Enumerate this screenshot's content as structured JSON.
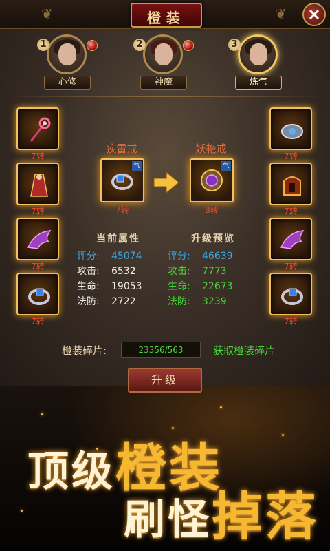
{
  "title": "橙装",
  "heroes": [
    {
      "num": "1",
      "label": "心修",
      "selected": false
    },
    {
      "num": "2",
      "label": "神魔",
      "selected": false
    },
    {
      "num": "3",
      "label": "炼气",
      "selected": true
    }
  ],
  "left_slots": [
    "7转",
    "7转",
    "7转",
    "7转"
  ],
  "right_slots": [
    "7转",
    "7转",
    "7转",
    "7转"
  ],
  "current_item": {
    "name": "疾雷戒",
    "level": "7转",
    "tag": "气"
  },
  "next_item": {
    "name": "妖艳戒",
    "level": "8转",
    "tag": "气"
  },
  "current_stats": {
    "header": "当前属性",
    "rows": [
      {
        "label": "评分:",
        "value": "45074"
      },
      {
        "label": "攻击:",
        "value": "6532"
      },
      {
        "label": "生命:",
        "value": "19053"
      },
      {
        "label": "法防:",
        "value": "2722"
      }
    ]
  },
  "upgrade_stats": {
    "header": "升级预览",
    "rows": [
      {
        "label": "评分:",
        "value": "46639"
      },
      {
        "label": "攻击:",
        "value": "7773"
      },
      {
        "label": "生命:",
        "value": "22673"
      },
      {
        "label": "法防:",
        "value": "3239"
      }
    ]
  },
  "shards": {
    "label": "橙装碎片:",
    "value": "23356/563",
    "link": "获取橙装碎片"
  },
  "upgrade_button": "升级",
  "promo": {
    "line1_a": "顶级",
    "line1_b": "橙装",
    "line2_a": "刷怪",
    "line2_b": "掉落"
  },
  "colors": {
    "accent_gold": "#f2c060",
    "stat_blue": "#3aa8e8",
    "stat_green": "#4ad33a",
    "level_red": "#e94a2a"
  }
}
